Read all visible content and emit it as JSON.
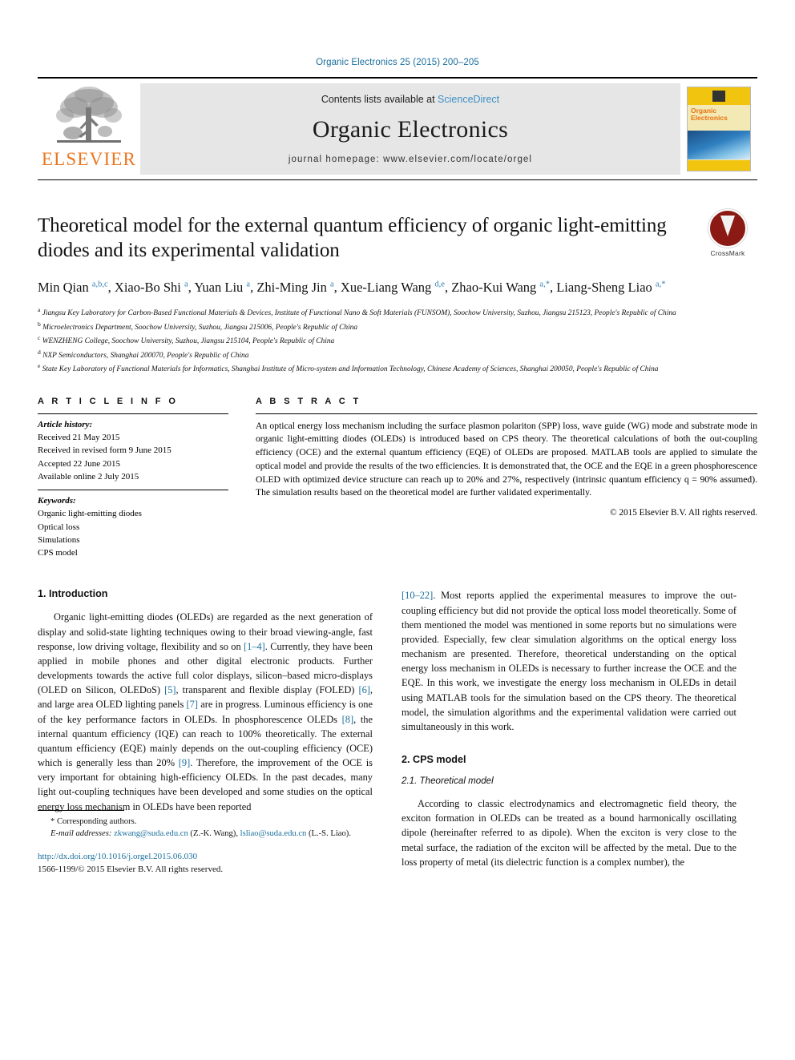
{
  "running_head": "Organic Electronics 25 (2015) 200–205",
  "masthead": {
    "publisher_wordmark": "ELSEVIER",
    "contents_prefix": "Contents lists available at ",
    "contents_link": "ScienceDirect",
    "journal_name": "Organic Electronics",
    "homepage_line": "journal homepage: www.elsevier.com/locate/orgel",
    "cover_title_line1": "Organic",
    "cover_title_line2": "Electronics"
  },
  "article": {
    "title": "Theoretical model for the external quantum efficiency of organic light-emitting diodes and its experimental validation",
    "crossmark_label": "CrossMark",
    "authors_html": "Min Qian <sup>a,b,c</sup>, Xiao-Bo Shi <sup>a</sup>, Yuan Liu <sup>a</sup>, Zhi-Ming Jin <sup>a</sup>, Xue-Liang Wang <sup>d,e</sup>, Zhao-Kui Wang <sup>a,*</sup>, Liang-Sheng Liao <sup>a,*</sup>",
    "affiliations": [
      "<sup>a</sup> Jiangsu Key Laboratory for Carbon-Based Functional Materials &amp; Devices, Institute of Functional Nano &amp; Soft Materials (FUNSOM), Soochow University, Suzhou, Jiangsu 215123, People's Republic of China",
      "<sup>b</sup> Microelectronics Department, Soochow University, Suzhou, Jiangsu 215006, People's Republic of China",
      "<sup>c</sup> WENZHENG College, Soochow University, Suzhou, Jiangsu 215104, People's Republic of China",
      "<sup>d</sup> NXP Semiconductors, Shanghai 200070, People's Republic of China",
      "<sup>e</sup> State Key Laboratory of Functional Materials for Informatics, Shanghai Institute of Micro-system and Information Technology, Chinese Academy of Sciences, Shanghai 200050, People's Republic of China"
    ]
  },
  "article_info": {
    "heading": "A R T I C L E   I N F O",
    "history_label": "Article history:",
    "history": [
      "Received 21 May 2015",
      "Received in revised form 9 June 2015",
      "Accepted 22 June 2015",
      "Available online 2 July 2015"
    ],
    "keywords_label": "Keywords:",
    "keywords": [
      "Organic light-emitting diodes",
      "Optical loss",
      "Simulations",
      "CPS model"
    ]
  },
  "abstract": {
    "heading": "A B S T R A C T",
    "text": "An optical energy loss mechanism including the surface plasmon polariton (SPP) loss, wave guide (WG) mode and substrate mode in organic light-emitting diodes (OLEDs) is introduced based on CPS theory. The theoretical calculations of both the out-coupling efficiency (OCE) and the external quantum efficiency (EQE) of OLEDs are proposed. MATLAB tools are applied to simulate the optical model and provide the results of the two efficiencies. It is demonstrated that, the OCE and the EQE in a green phosphorescence OLED with optimized device structure can reach up to 20% and 27%, respectively (intrinsic quantum efficiency q = 90% assumed). The simulation results based on the theoretical model are further validated experimentally.",
    "copyright": "© 2015 Elsevier B.V. All rights reserved."
  },
  "body": {
    "intro_heading": "1. Introduction",
    "intro_p1_html": "Organic light-emitting diodes (OLEDs) are regarded as the next generation of display and solid-state lighting techniques owing to their broad viewing-angle, fast response, low driving voltage, flexibility and so on <span class=\"ref\">[1–4]</span>. Currently, they have been applied in mobile phones and other digital electronic products. Further developments towards the active full color displays, silicon–based micro-displays (OLED on Silicon, OLEDoS) <span class=\"ref\">[5]</span>, transparent and flexible display (FOLED) <span class=\"ref\">[6]</span>, and large area OLED lighting panels <span class=\"ref\">[7]</span> are in progress. Luminous efficiency is one of the key performance factors in OLEDs. In phosphorescence OLEDs <span class=\"ref\">[8]</span>, the internal quantum efficiency (IQE) can reach to 100% theoretically. The external quantum efficiency (EQE) mainly depends on the out-coupling efficiency (OCE) which is generally less than 20% <span class=\"ref\">[9]</span>. Therefore, the improvement of the OCE is very important for obtaining high-efficiency OLEDs. In the past decades, many light out-coupling techniques have been developed and some studies on the optical energy loss mechanism in OLEDs have been reported",
    "intro_p2_html": "<span class=\"ref\">[10–22]</span>. Most reports applied the experimental measures to improve the out-coupling efficiency but did not provide the optical loss model theoretically. Some of them mentioned the model was mentioned in some reports but no simulations were provided. Especially, few clear simulation algorithms on the optical energy loss mechanism are presented. Therefore, theoretical understanding on the optical energy loss mechanism in OLEDs is necessary to further increase the OCE and the EQE. In this work, we investigate the energy loss mechanism in OLEDs in detail using MATLAB tools for the simulation based on the CPS theory. The theoretical model, the simulation algorithms and the experimental validation were carried out simultaneously in this work.",
    "cps_heading": "2. CPS model",
    "cps_sub_heading": "2.1. Theoretical model",
    "cps_p1_html": "According to classic electrodynamics and electromagnetic field theory, the exciton formation in OLEDs can be treated as a bound harmonically oscillating dipole (hereinafter referred to as dipole). When the exciton is very close to the metal surface, the radiation of the exciton will be affected by the metal. Due to the loss property of metal (its dielectric function is a complex number), the"
  },
  "footer": {
    "corresponding_note": "* Corresponding authors.",
    "email_html": "<span class=\"ital-label\"><i>E-mail addresses:</i></span> <span class=\"lnk\">zkwang@suda.edu.cn</span> (Z.-K. Wang), <span class=\"lnk\">lsliao@suda.edu.cn</span> (L.-S. Liao).",
    "doi": "http://dx.doi.org/10.1016/j.orgel.2015.06.030",
    "issn": "1566-1199/© 2015 Elsevier B.V. All rights reserved."
  }
}
